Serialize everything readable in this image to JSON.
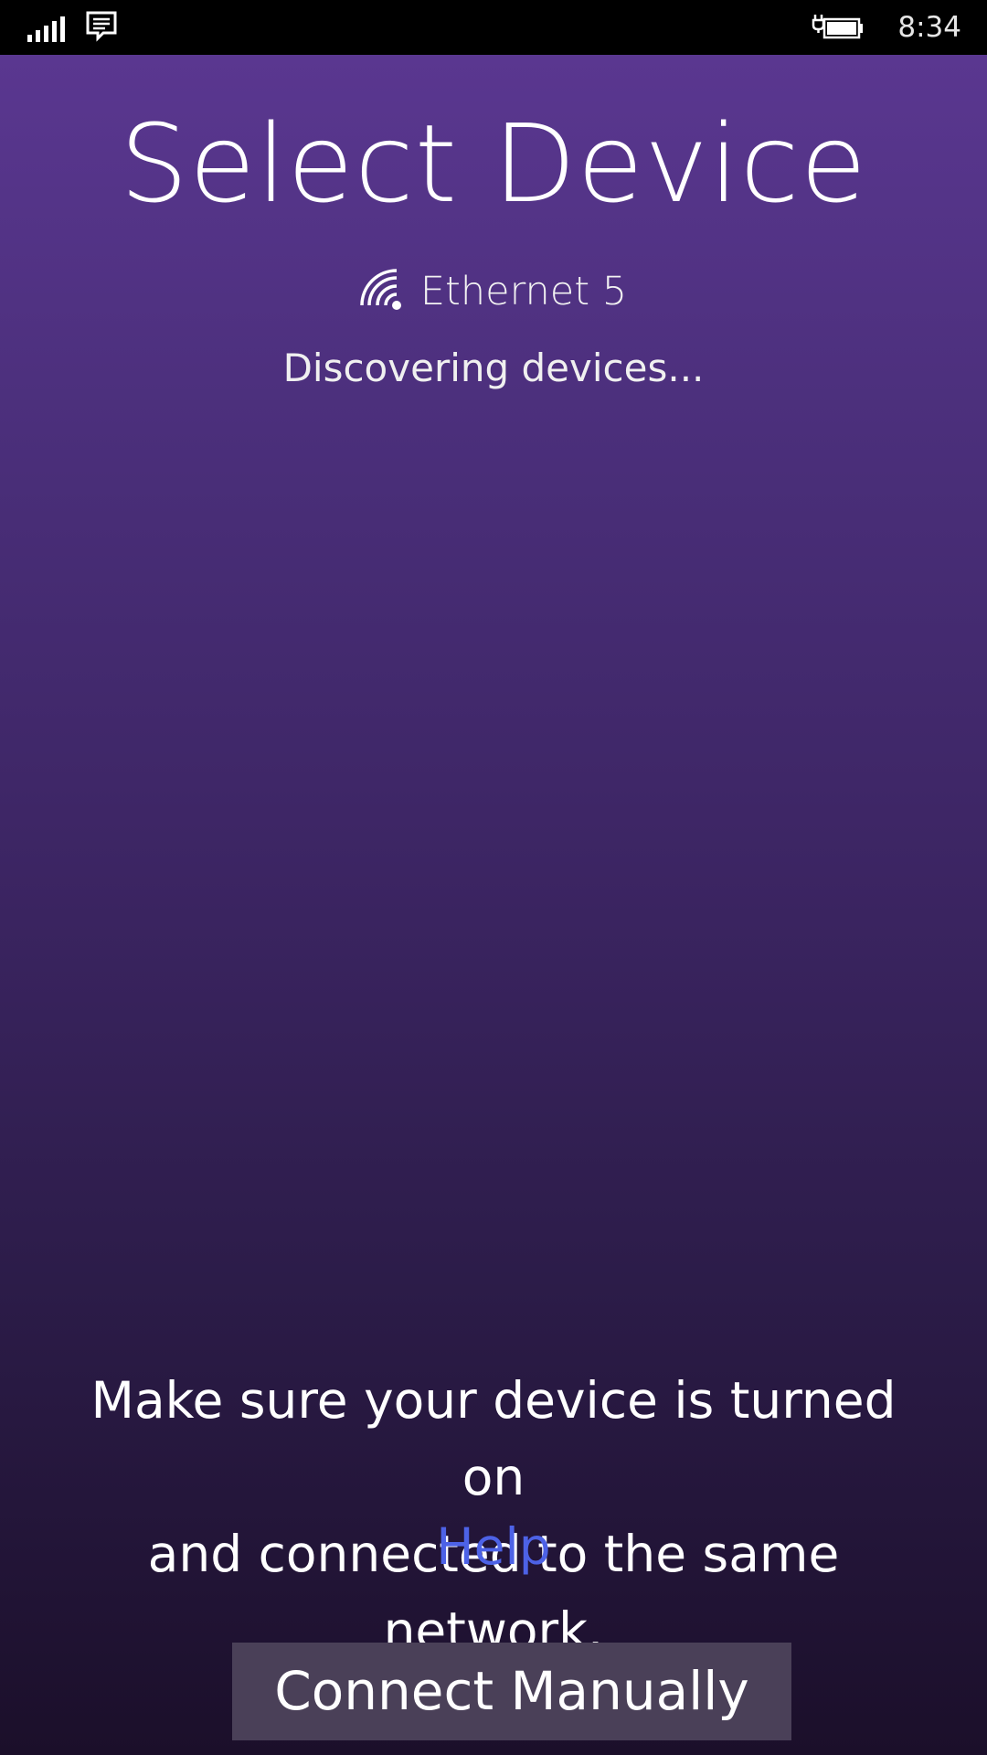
{
  "status_bar": {
    "time": "8:34",
    "signal_icon": "signal-bars-icon",
    "message_icon": "message-icon",
    "battery_icon": "battery-charging-icon"
  },
  "screen": {
    "title": "Select Device",
    "network": {
      "icon": "wifi-icon",
      "name": "Ethernet 5"
    },
    "status": "Discovering devices...",
    "hint_line1": "Make sure your device is turned on",
    "hint_line2": "and connected to the same network.",
    "help_link": "Help",
    "connect_button": "Connect Manually"
  },
  "colors": {
    "background_top": "#5a3790",
    "background_bottom": "#1b0f2a",
    "link": "#4d62e6",
    "button": "#4a4058"
  }
}
